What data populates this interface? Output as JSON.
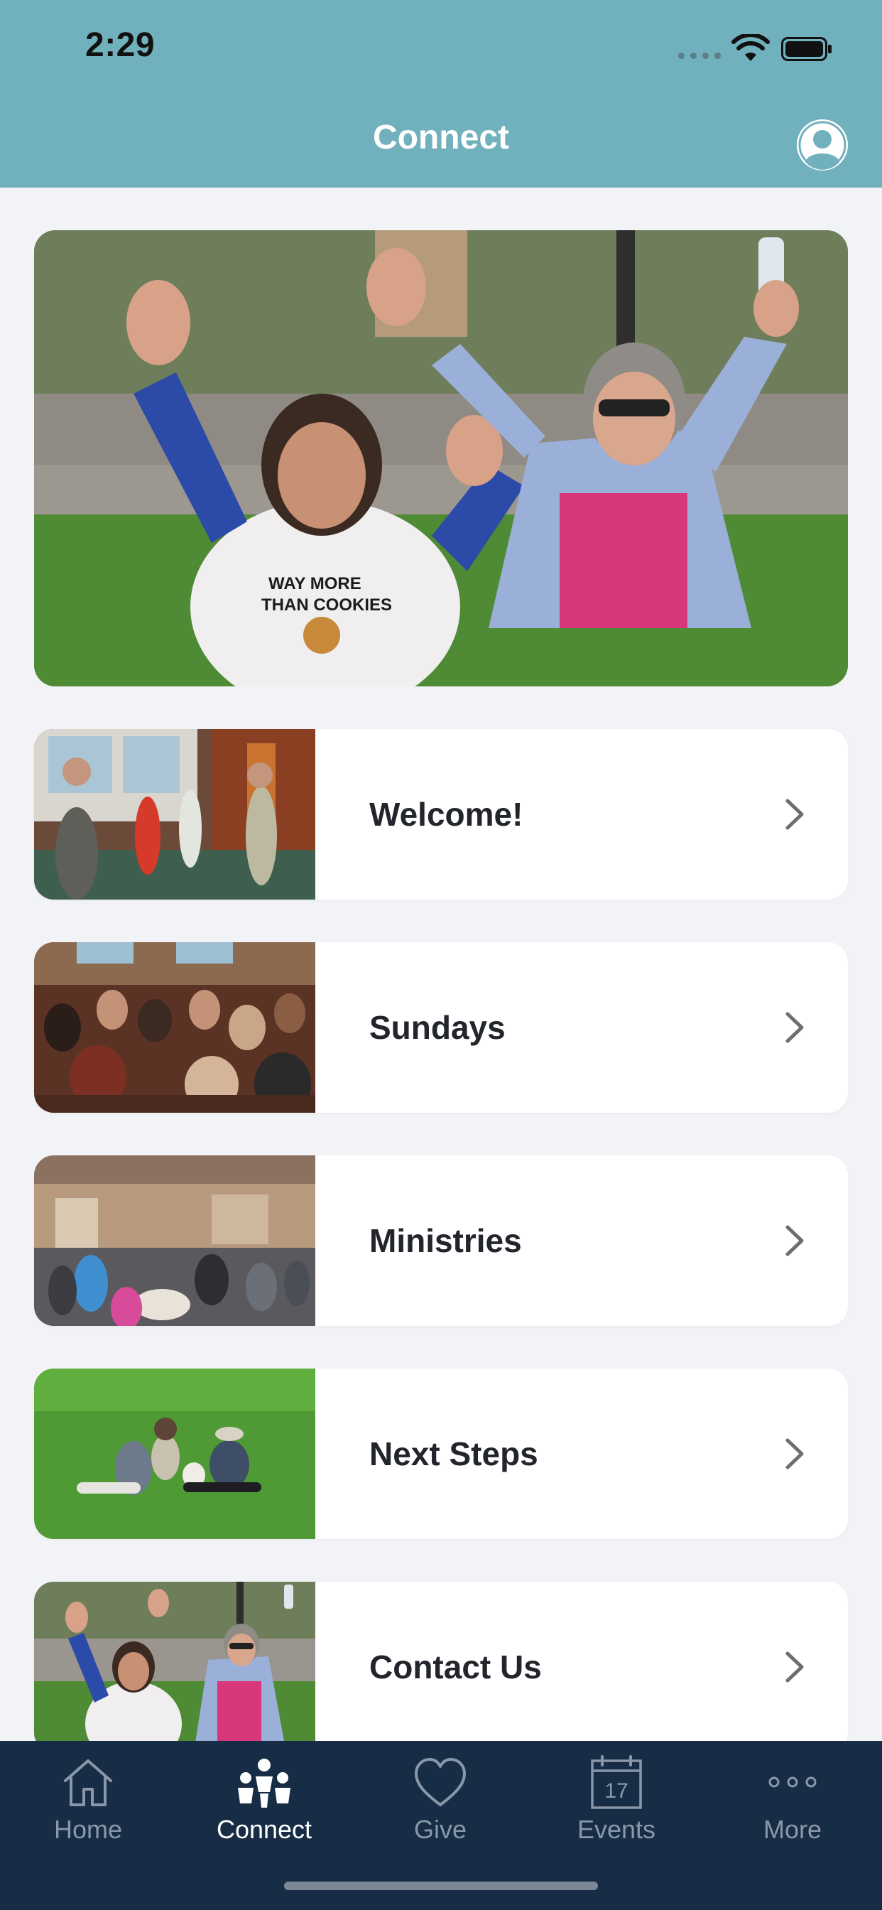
{
  "status_bar": {
    "time": "2:29"
  },
  "header": {
    "title": "Connect",
    "profile_icon": "user-circle-icon"
  },
  "hero": {
    "image": "two-women-waving-photo"
  },
  "menu": [
    {
      "label": "Welcome!",
      "image": "lobby-greeting-photo"
    },
    {
      "label": "Sundays",
      "image": "congregation-seated-photo"
    },
    {
      "label": "Ministries",
      "image": "fellowship-hall-photo"
    },
    {
      "label": "Next Steps",
      "image": "family-on-lawn-photo"
    },
    {
      "label": "Contact Us",
      "image": "two-women-waving-photo"
    }
  ],
  "tabs": [
    {
      "label": "Home",
      "icon": "home-icon",
      "active": false
    },
    {
      "label": "Connect",
      "icon": "people-icon",
      "active": true
    },
    {
      "label": "Give",
      "icon": "heart-icon",
      "active": false
    },
    {
      "label": "Events",
      "icon": "calendar-icon",
      "calendar_day": "17",
      "active": false
    },
    {
      "label": "More",
      "icon": "more-dots-icon",
      "active": false
    }
  ],
  "colors": {
    "header_bg": "#71b0bd",
    "page_bg": "#f2f3f7",
    "tabbar_bg": "#172d45",
    "tab_inactive": "#8a97a8",
    "tab_active": "#ffffff"
  }
}
